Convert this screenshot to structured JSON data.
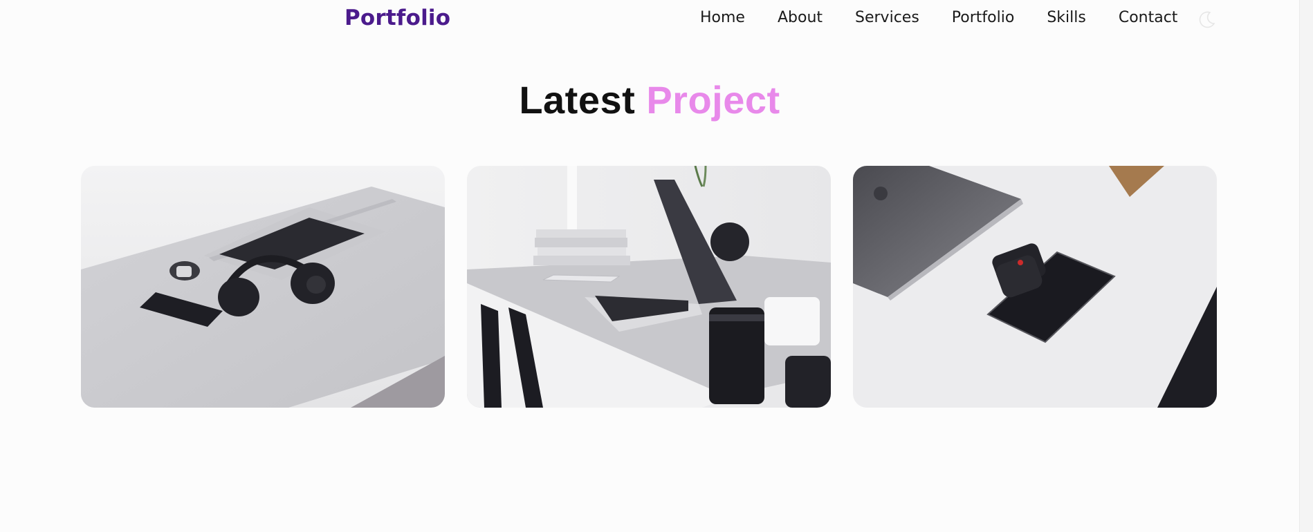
{
  "header": {
    "logo": "Portfolio",
    "nav": [
      "Home",
      "About",
      "Services",
      "Portfolio",
      "Skills",
      "Contact"
    ],
    "theme_toggle_icon": "moon-icon"
  },
  "section": {
    "title_main": "Latest",
    "title_accent": "Project"
  },
  "projects": [
    {
      "image": "desk-laptop-headphones-photo"
    },
    {
      "image": "desk-laptop-camera-lens-photo"
    },
    {
      "image": "laptop-smartwatch-phone-photo"
    }
  ],
  "colors": {
    "logo": "#4b1b8c",
    "accent": "#e889ea",
    "background": "#fcfcfc"
  }
}
